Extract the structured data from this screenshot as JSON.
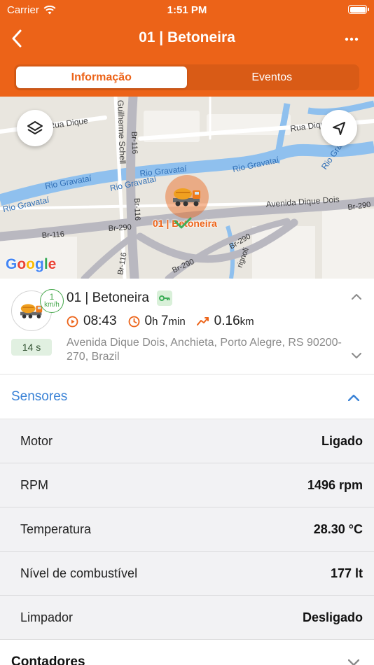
{
  "status_bar": {
    "carrier": "Carrier",
    "time": "1:51 PM",
    "battery_level": 1.0
  },
  "nav": {
    "title": "01 | Betoneira",
    "back_icon": "chevron-left-icon",
    "more_icon": "ellipsis-icon"
  },
  "tabs": [
    {
      "label": "Informação",
      "active": true
    },
    {
      "label": "Eventos",
      "active": false
    }
  ],
  "map": {
    "google_logo": "Google",
    "marker_label": "01 | Betoneira",
    "streets": [
      "Rua Dique",
      "Rua Dique",
      "Guilherme Schell",
      "Br-116",
      "Rio Gravataí",
      "Rio Gravataí",
      "Rio Gravataí",
      "Rio Gravataí",
      "Rio Gravataí",
      "Rio Gravataí",
      "Avenida Dique Dois",
      "Br-290",
      "Br-290",
      "Br-290",
      "Br-290",
      "Br-116",
      "Br-116",
      "Br-116",
      "Br-290",
      "Rio Gravataí",
      "Br-116",
      "Br-290",
      "Br-290",
      "rignoli"
    ],
    "layers_icon": "layers-icon",
    "locate_icon": "navigation-arrow-icon"
  },
  "vehicle": {
    "name": "01 | Betoneira",
    "speed_value": "1",
    "speed_unit": "km/h",
    "elapsed": "14 s",
    "time": "08:43",
    "duration_hours": "0",
    "duration_h_unit": "h",
    "duration_minutes": "7",
    "duration_min_unit": "min",
    "distance": "0.16",
    "distance_unit": "km",
    "address": "Avenida Dique Dois, Anchieta, Porto Alegre, RS 90200-270, Brazil",
    "ignition_icon": "key-icon",
    "colors": {
      "accent": "#ec6318",
      "speed_green": "#46a84c",
      "link_blue": "#3a82d6"
    }
  },
  "sections": {
    "sensors_title": "Sensores",
    "counters_title": "Contadores"
  },
  "sensors": [
    {
      "name": "Motor",
      "value": "Ligado"
    },
    {
      "name": "RPM",
      "value": "1496 rpm"
    },
    {
      "name": "Temperatura",
      "value": "28.30 °C"
    },
    {
      "name": "Nível de combustível",
      "value": "177 lt"
    },
    {
      "name": "Limpador",
      "value": "Desligado"
    }
  ]
}
